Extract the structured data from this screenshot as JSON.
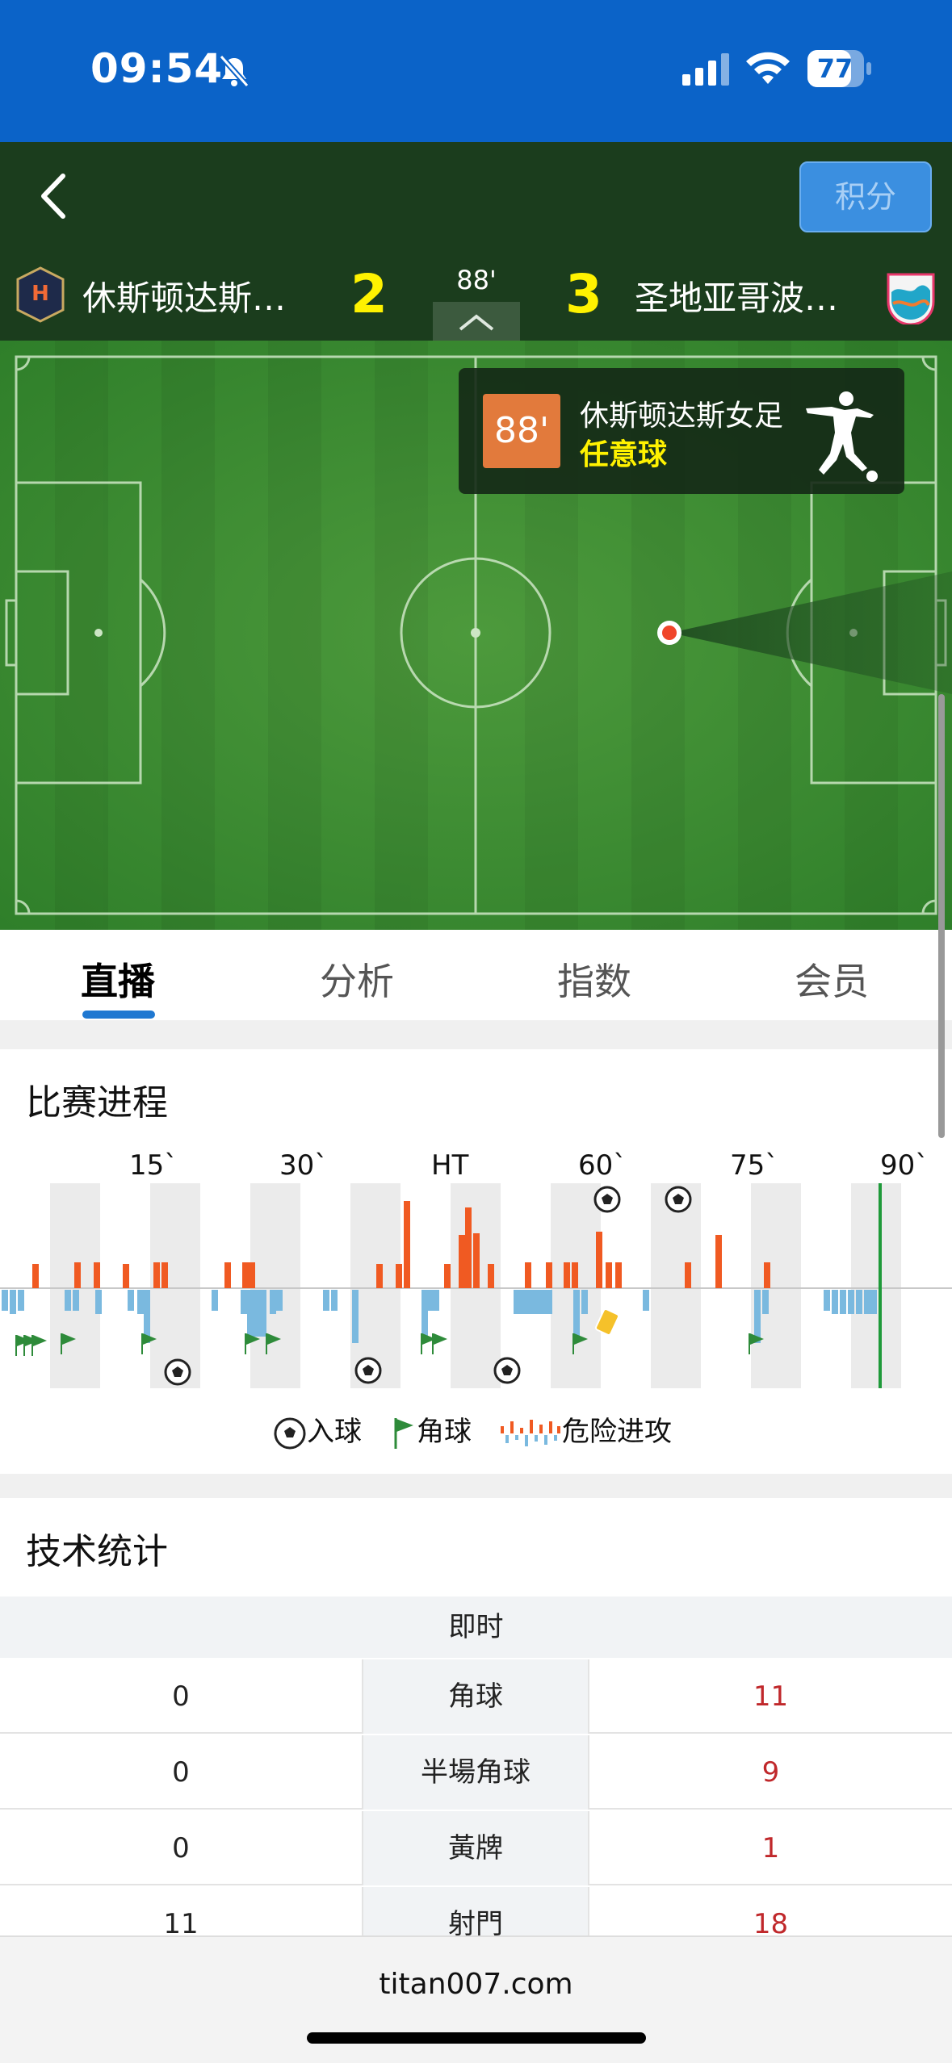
{
  "status_bar": {
    "time": "09:54",
    "battery": "77"
  },
  "header": {
    "points_label": "积分",
    "home_team": "休斯顿达斯…",
    "away_team": "圣地亚哥波…",
    "home_score": "2",
    "away_score": "3",
    "minute": "88'"
  },
  "event": {
    "minute": "88'",
    "team": "休斯顿达斯女足",
    "type": "任意球"
  },
  "tabs": [
    {
      "label": "直播",
      "active": true
    },
    {
      "label": "分析",
      "active": false
    },
    {
      "label": "指数",
      "active": false
    },
    {
      "label": "会员",
      "active": false
    }
  ],
  "progress": {
    "title": "比赛进程",
    "ticks": [
      "15`",
      "30`",
      "HT",
      "60`",
      "75`",
      "90`"
    ],
    "current_minute": 88,
    "legend": {
      "goal": "入球",
      "corner": "角球",
      "attack": "危险进攻"
    }
  },
  "stats": {
    "title": "技术统计",
    "header": "即时",
    "rows": [
      {
        "label": "角球",
        "home": "0",
        "away": "11"
      },
      {
        "label": "半場角球",
        "home": "0",
        "away": "9"
      },
      {
        "label": "黃牌",
        "home": "0",
        "away": "1"
      },
      {
        "label": "射門",
        "home": "11",
        "away": "18"
      }
    ]
  },
  "footer": {
    "url": "titan007.com"
  },
  "colors": {
    "status_blue": "#0b63c8",
    "header_green": "#1b3d1d",
    "score_yellow": "#fff200",
    "attack_orange": "#f05a22",
    "attack_blue": "#7ab9df",
    "accent_blue": "#1f78d1",
    "away_stat_red": "#c0282b"
  }
}
